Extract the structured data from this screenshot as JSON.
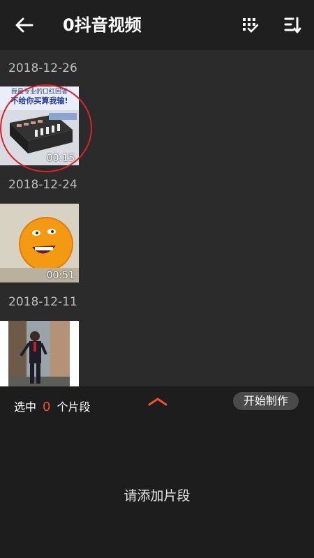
{
  "header": {
    "title": "0抖音视频",
    "back_icon": "arrow-left-icon",
    "select_icon": "multi-select-icon",
    "sort_icon": "sort-icon"
  },
  "groups": [
    {
      "date": "2018-12-26",
      "duration": "00:15",
      "thumb_text": [
        "我最专业的口红回答",
        "不给你买算我输!"
      ],
      "highlighted": true
    },
    {
      "date": "2018-12-24",
      "duration": "00:51"
    },
    {
      "date": "2018-12-11",
      "duration": ""
    }
  ],
  "footer": {
    "selected_prefix": "选中",
    "selected_count": "0",
    "selected_suffix": "个片段",
    "expand_icon": "chevron-up-icon",
    "start_button": "开始制作",
    "empty_hint": "请添加片段"
  },
  "colors": {
    "accent": "#f0532b",
    "highlight_circle": "#e0202a",
    "topbar": "#1f1f1f",
    "background": "#2b2b2b"
  }
}
